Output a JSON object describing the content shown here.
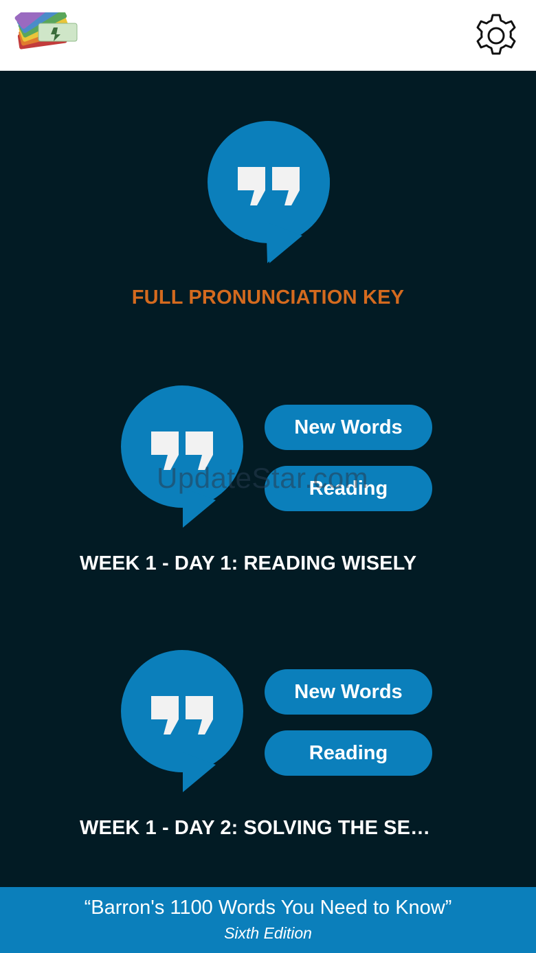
{
  "header": {
    "logo_icon": "flashcard-fan-logo",
    "settings_icon": "gear-icon"
  },
  "pronunciation_key": {
    "icon": "quote-bubble-icon",
    "title": "FULL PRONUNCIATION KEY",
    "title_color": "#d46a1e"
  },
  "lessons": [
    {
      "icon": "quote-bubble-icon",
      "new_words_label": "New Words",
      "reading_label": "Reading",
      "title": "WEEK 1 - DAY 1: READING WISELY"
    },
    {
      "icon": "quote-bubble-icon",
      "new_words_label": "New Words",
      "reading_label": "Reading",
      "title": "WEEK 1 - DAY 2: SOLVING THE SE…"
    }
  ],
  "watermark": "UpdateStar.com",
  "footer": {
    "title": "“Barron's 1100 Words You Need to Know”",
    "subtitle": "Sixth Edition"
  },
  "colors": {
    "accent": "#0b7fbb",
    "background": "#021b24",
    "quote_mark": "#f2f2f2"
  }
}
